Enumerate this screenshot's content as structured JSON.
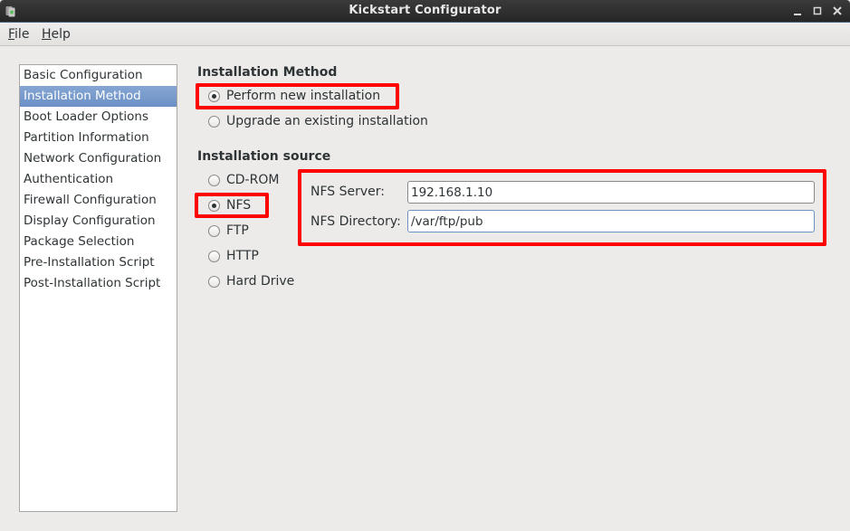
{
  "window": {
    "title": "Kickstart Configurator",
    "icons": {
      "app": "kickstart-app-icon",
      "minimize": "minimize-icon",
      "maximize": "maximize-icon",
      "close": "close-icon"
    },
    "controls": {
      "minimize": "_",
      "maximize": "□",
      "close": "X"
    }
  },
  "menu": [
    {
      "label": "File",
      "mnemonic": "F",
      "rest": "ile"
    },
    {
      "label": "Help",
      "mnemonic": "H",
      "rest": "elp"
    }
  ],
  "sidebar": {
    "selected": "Installation Method",
    "items": [
      {
        "label": "Basic Configuration"
      },
      {
        "label": "Installation Method"
      },
      {
        "label": "Boot Loader Options"
      },
      {
        "label": "Partition Information"
      },
      {
        "label": "Network Configuration"
      },
      {
        "label": "Authentication"
      },
      {
        "label": "Firewall Configuration"
      },
      {
        "label": "Display Configuration"
      },
      {
        "label": "Package Selection"
      },
      {
        "label": "Pre-Installation Script"
      },
      {
        "label": "Post-Installation Script"
      }
    ]
  },
  "installation_method": {
    "title": "Installation Method",
    "options": [
      {
        "label": "Perform new installation",
        "checked": true
      },
      {
        "label": "Upgrade an existing installation",
        "checked": false
      }
    ]
  },
  "installation_source": {
    "title": "Installation source",
    "options": [
      {
        "label": "CD-ROM",
        "checked": false
      },
      {
        "label": "NFS",
        "checked": true
      },
      {
        "label": "FTP",
        "checked": false
      },
      {
        "label": "HTTP",
        "checked": false
      },
      {
        "label": "Hard Drive",
        "checked": false
      }
    ],
    "nfs": {
      "server_label": "NFS Server:",
      "server_value": "192.168.1.10",
      "directory_label": "NFS Directory:",
      "directory_value": "/var/ftp/pub"
    }
  },
  "colors": {
    "highlight_annotation": "#ff0000",
    "selection": "#6a8fc4",
    "titlebar": "#2b2b2b",
    "background": "#edebe9"
  }
}
